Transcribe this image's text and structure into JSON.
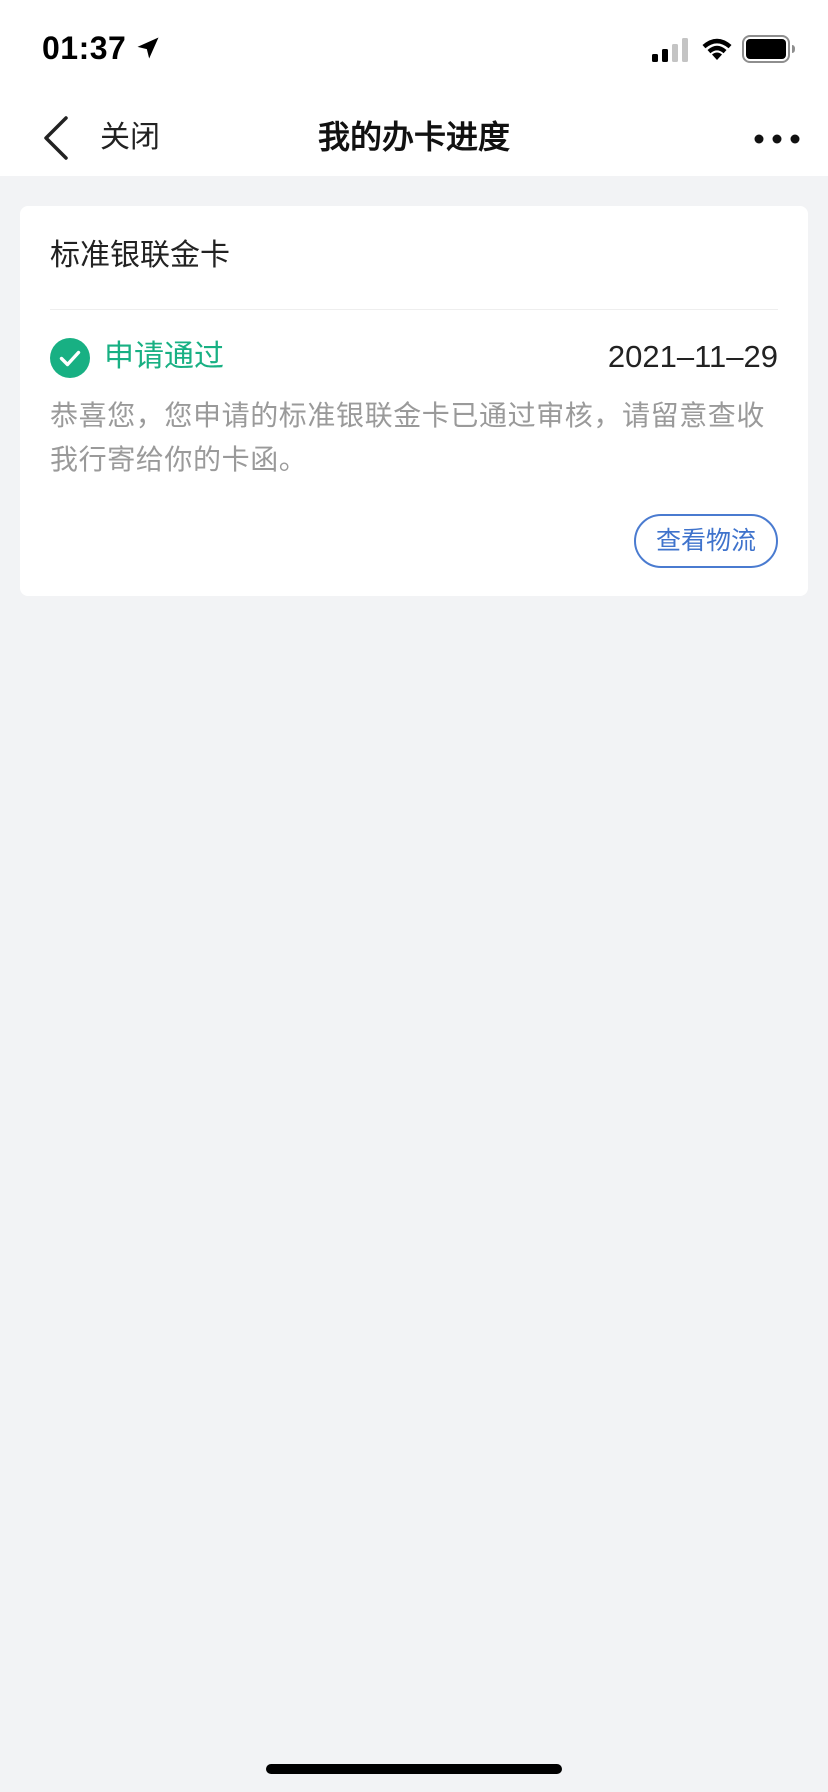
{
  "status_bar": {
    "time": "01:37",
    "icons": [
      "location-arrow-icon",
      "signal-icon",
      "wifi-icon",
      "battery-icon"
    ]
  },
  "nav": {
    "back_icon": "chevron-left-icon",
    "close_label": "关闭",
    "title": "我的办卡进度",
    "more_icon": "more-dots-icon"
  },
  "card": {
    "title": "标准银联金卡",
    "status": {
      "icon": "check-circle-icon",
      "label": "申请通过",
      "date": "2021–11–29",
      "message": "恭喜您，您申请的标准银联金卡已通过审核，请留意查收我行寄给你的卡函。"
    },
    "logistics_button_label": "查看物流"
  },
  "colors": {
    "page_background": "#f2f3f5",
    "card_background": "#ffffff",
    "success_green": "#18b083",
    "link_blue": "#3f73cc",
    "secondary_text": "#9a9a9a"
  }
}
